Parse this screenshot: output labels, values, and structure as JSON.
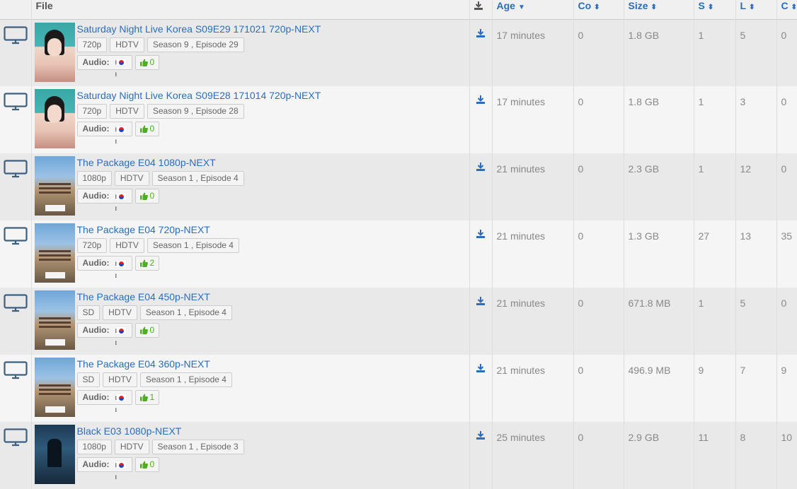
{
  "header": {
    "file": "File",
    "age": "Age",
    "co": "Co",
    "size": "Size",
    "s": "S",
    "l": "L",
    "c": "C"
  },
  "colors": {
    "link": "#2a6ebb",
    "thumb": "#4caf20"
  },
  "rows": [
    {
      "title": "Saturday Night Live Korea S09E29 171021 720p-NEXT",
      "poster": "snl-poster",
      "quality": "720p",
      "source": "HDTV",
      "episode": "Season 9 , Episode 29",
      "audio_label": "Audio:",
      "likes": "0",
      "age": "17 minutes",
      "co": "0",
      "size": "1.8 GB",
      "s": "1",
      "l": "5",
      "c": "0"
    },
    {
      "title": "Saturday Night Live Korea S09E28 171014 720p-NEXT",
      "poster": "snl-poster",
      "quality": "720p",
      "source": "HDTV",
      "episode": "Season 9 , Episode 28",
      "audio_label": "Audio:",
      "likes": "0",
      "age": "17 minutes",
      "co": "0",
      "size": "1.8 GB",
      "s": "1",
      "l": "3",
      "c": "0"
    },
    {
      "title": "The Package E04 1080p-NEXT",
      "poster": "package-poster",
      "quality": "1080p",
      "source": "HDTV",
      "episode": "Season 1 , Episode 4",
      "audio_label": "Audio:",
      "likes": "0",
      "age": "21 minutes",
      "co": "0",
      "size": "2.3 GB",
      "s": "1",
      "l": "12",
      "c": "0"
    },
    {
      "title": "The Package E04 720p-NEXT",
      "poster": "package-poster",
      "quality": "720p",
      "source": "HDTV",
      "episode": "Season 1 , Episode 4",
      "audio_label": "Audio:",
      "likes": "2",
      "age": "21 minutes",
      "co": "0",
      "size": "1.3 GB",
      "s": "27",
      "l": "13",
      "c": "35"
    },
    {
      "title": "The Package E04 450p-NEXT",
      "poster": "package-poster",
      "quality": "SD",
      "source": "HDTV",
      "episode": "Season 1 , Episode 4",
      "audio_label": "Audio:",
      "likes": "0",
      "age": "21 minutes",
      "co": "0",
      "size": "671.8 MB",
      "s": "1",
      "l": "5",
      "c": "0"
    },
    {
      "title": "The Package E04 360p-NEXT",
      "poster": "package-poster",
      "quality": "SD",
      "source": "HDTV",
      "episode": "Season 1 , Episode 4",
      "audio_label": "Audio:",
      "likes": "1",
      "age": "21 minutes",
      "co": "0",
      "size": "496.9 MB",
      "s": "9",
      "l": "7",
      "c": "9"
    },
    {
      "title": "Black E03 1080p-NEXT",
      "poster": "black-poster",
      "quality": "1080p",
      "source": "HDTV",
      "episode": "Season 1 , Episode 3",
      "audio_label": "Audio:",
      "likes": "0",
      "age": "25 minutes",
      "co": "0",
      "size": "2.9 GB",
      "s": "11",
      "l": "8",
      "c": "10"
    }
  ]
}
